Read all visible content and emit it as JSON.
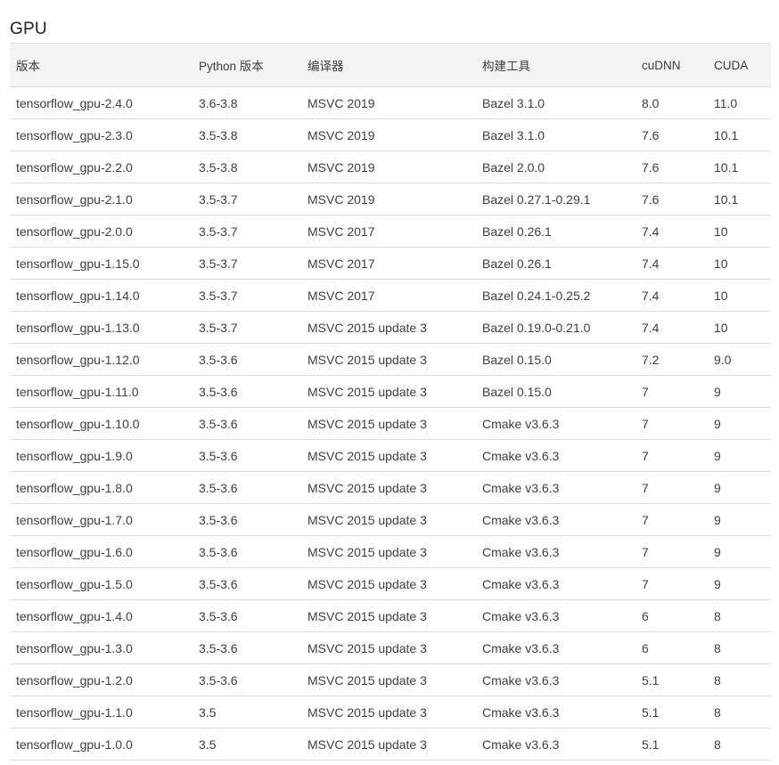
{
  "title": "GPU",
  "table": {
    "headers": [
      "版本",
      "Python 版本",
      "编译器",
      "构建工具",
      "cuDNN",
      "CUDA"
    ],
    "rows": [
      [
        "tensorflow_gpu-2.4.0",
        "3.6-3.8",
        "MSVC 2019",
        "Bazel 3.1.0",
        "8.0",
        "11.0"
      ],
      [
        "tensorflow_gpu-2.3.0",
        "3.5-3.8",
        "MSVC 2019",
        "Bazel 3.1.0",
        "7.6",
        "10.1"
      ],
      [
        "tensorflow_gpu-2.2.0",
        "3.5-3.8",
        "MSVC 2019",
        "Bazel 2.0.0",
        "7.6",
        "10.1"
      ],
      [
        "tensorflow_gpu-2.1.0",
        "3.5-3.7",
        "MSVC 2019",
        "Bazel 0.27.1-0.29.1",
        "7.6",
        "10.1"
      ],
      [
        "tensorflow_gpu-2.0.0",
        "3.5-3.7",
        "MSVC 2017",
        "Bazel 0.26.1",
        "7.4",
        "10"
      ],
      [
        "tensorflow_gpu-1.15.0",
        "3.5-3.7",
        "MSVC 2017",
        "Bazel 0.26.1",
        "7.4",
        "10"
      ],
      [
        "tensorflow_gpu-1.14.0",
        "3.5-3.7",
        "MSVC 2017",
        "Bazel 0.24.1-0.25.2",
        "7.4",
        "10"
      ],
      [
        "tensorflow_gpu-1.13.0",
        "3.5-3.7",
        "MSVC 2015 update 3",
        "Bazel 0.19.0-0.21.0",
        "7.4",
        "10"
      ],
      [
        "tensorflow_gpu-1.12.0",
        "3.5-3.6",
        "MSVC 2015 update 3",
        "Bazel 0.15.0",
        "7.2",
        "9.0"
      ],
      [
        "tensorflow_gpu-1.11.0",
        "3.5-3.6",
        "MSVC 2015 update 3",
        "Bazel 0.15.0",
        "7",
        "9"
      ],
      [
        "tensorflow_gpu-1.10.0",
        "3.5-3.6",
        "MSVC 2015 update 3",
        "Cmake v3.6.3",
        "7",
        "9"
      ],
      [
        "tensorflow_gpu-1.9.0",
        "3.5-3.6",
        "MSVC 2015 update 3",
        "Cmake v3.6.3",
        "7",
        "9"
      ],
      [
        "tensorflow_gpu-1.8.0",
        "3.5-3.6",
        "MSVC 2015 update 3",
        "Cmake v3.6.3",
        "7",
        "9"
      ],
      [
        "tensorflow_gpu-1.7.0",
        "3.5-3.6",
        "MSVC 2015 update 3",
        "Cmake v3.6.3",
        "7",
        "9"
      ],
      [
        "tensorflow_gpu-1.6.0",
        "3.5-3.6",
        "MSVC 2015 update 3",
        "Cmake v3.6.3",
        "7",
        "9"
      ],
      [
        "tensorflow_gpu-1.5.0",
        "3.5-3.6",
        "MSVC 2015 update 3",
        "Cmake v3.6.3",
        "7",
        "9"
      ],
      [
        "tensorflow_gpu-1.4.0",
        "3.5-3.6",
        "MSVC 2015 update 3",
        "Cmake v3.6.3",
        "6",
        "8"
      ],
      [
        "tensorflow_gpu-1.3.0",
        "3.5-3.6",
        "MSVC 2015 update 3",
        "Cmake v3.6.3",
        "6",
        "8"
      ],
      [
        "tensorflow_gpu-1.2.0",
        "3.5-3.6",
        "MSVC 2015 update 3",
        "Cmake v3.6.3",
        "5.1",
        "8"
      ],
      [
        "tensorflow_gpu-1.1.0",
        "3.5",
        "MSVC 2015 update 3",
        "Cmake v3.6.3",
        "5.1",
        "8"
      ],
      [
        "tensorflow_gpu-1.0.0",
        "3.5",
        "MSVC 2015 update 3",
        "Cmake v3.6.3",
        "5.1",
        "8"
      ]
    ]
  }
}
